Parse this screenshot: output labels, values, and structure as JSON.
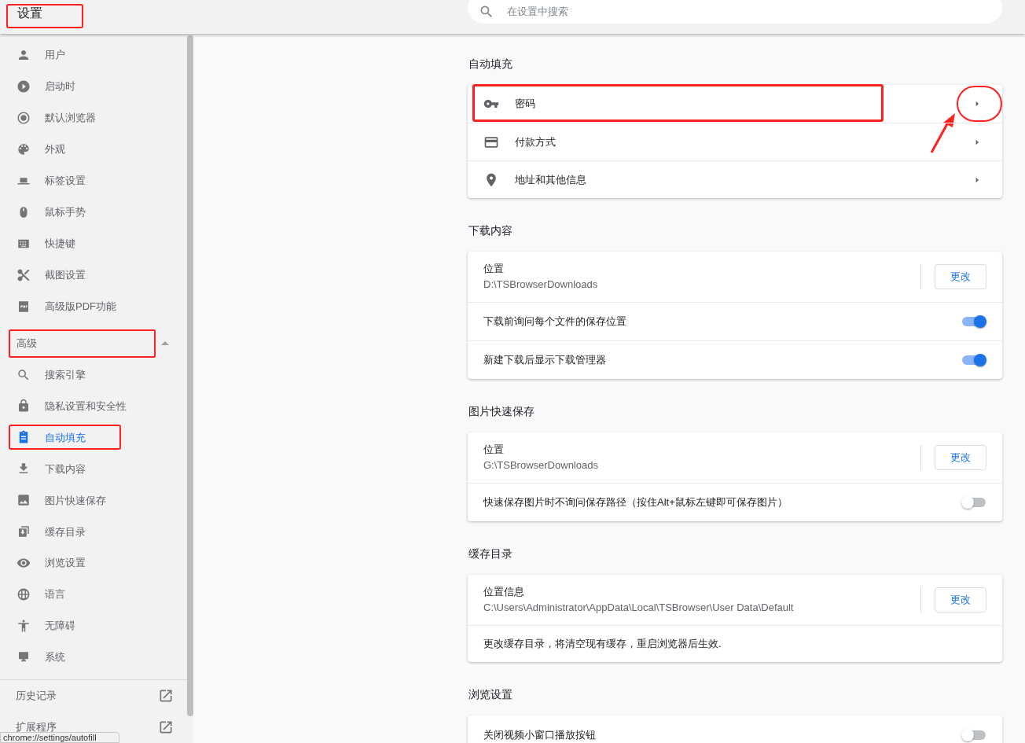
{
  "header": {
    "title": "设置",
    "highlighted": true,
    "search": {
      "placeholder": "在设置中搜索"
    }
  },
  "sidebar": {
    "items": [
      {
        "label": "用户",
        "selected": false
      },
      {
        "label": "启动时",
        "selected": false
      },
      {
        "label": "默认浏览器",
        "selected": false
      },
      {
        "label": "外观",
        "selected": false
      },
      {
        "label": "标签设置",
        "selected": false
      },
      {
        "label": "鼠标手势",
        "selected": false
      },
      {
        "label": "快捷键",
        "selected": false
      },
      {
        "label": "截图设置",
        "selected": false
      },
      {
        "label": "高级版PDF功能",
        "selected": false
      }
    ],
    "advanced": {
      "label": "高级",
      "expanded": true,
      "highlighted": true,
      "items": [
        {
          "label": "搜索引擎",
          "selected": false,
          "highlighted": false
        },
        {
          "label": "隐私设置和安全性",
          "selected": false,
          "highlighted": false
        },
        {
          "label": "自动填充",
          "selected": true,
          "highlighted": true
        },
        {
          "label": "下载内容",
          "selected": false,
          "highlighted": false
        },
        {
          "label": "图片快速保存",
          "selected": false,
          "highlighted": false
        },
        {
          "label": "缓存目录",
          "selected": false,
          "highlighted": false
        },
        {
          "label": "浏览设置",
          "selected": false,
          "highlighted": false
        },
        {
          "label": "语言",
          "selected": false,
          "highlighted": false
        },
        {
          "label": "无障碍",
          "selected": false,
          "highlighted": false
        },
        {
          "label": "系统",
          "selected": false,
          "highlighted": false
        }
      ]
    },
    "links": [
      {
        "label": "历史记录"
      },
      {
        "label": "扩展程序"
      }
    ]
  },
  "status_url": "chrome://settings/autofill",
  "sections": [
    {
      "title": "自动填充",
      "rows": [
        {
          "kind": "link",
          "label": "密码",
          "highlighted": true,
          "chevron_circled": true
        },
        {
          "kind": "link",
          "label": "付款方式",
          "highlighted": false,
          "chevron_circled": false
        },
        {
          "kind": "link",
          "label": "地址和其他信息",
          "highlighted": false,
          "chevron_circled": false
        }
      ]
    },
    {
      "title": "下载内容",
      "rows": [
        {
          "kind": "location",
          "label": "位置",
          "path": "D:\\TSBrowserDownloads",
          "button": "更改"
        },
        {
          "kind": "toggle",
          "label": "下载前询问每个文件的保存位置",
          "on": true
        },
        {
          "kind": "toggle",
          "label": "新建下载后显示下载管理器",
          "on": true
        }
      ]
    },
    {
      "title": "图片快速保存",
      "rows": [
        {
          "kind": "location",
          "label": "位置",
          "path": "G:\\TSBrowserDownloads",
          "button": "更改"
        },
        {
          "kind": "toggle",
          "label": "快速保存图片时不询问保存路径（按住Alt+鼠标左键即可保存图片）",
          "on": false
        }
      ]
    },
    {
      "title": "缓存目录",
      "rows": [
        {
          "kind": "location",
          "label": "位置信息",
          "path": "C:\\Users\\Administrator\\AppData\\Local\\TSBrowser\\User Data\\Default",
          "button": "更改"
        },
        {
          "kind": "note",
          "label": "更改缓存目录，将清空现有缓存，重启浏览器后生效."
        }
      ]
    },
    {
      "title": "浏览设置",
      "rows": [
        {
          "kind": "toggle",
          "label": "关闭视频小窗口播放按钮",
          "on": false
        }
      ]
    }
  ]
}
